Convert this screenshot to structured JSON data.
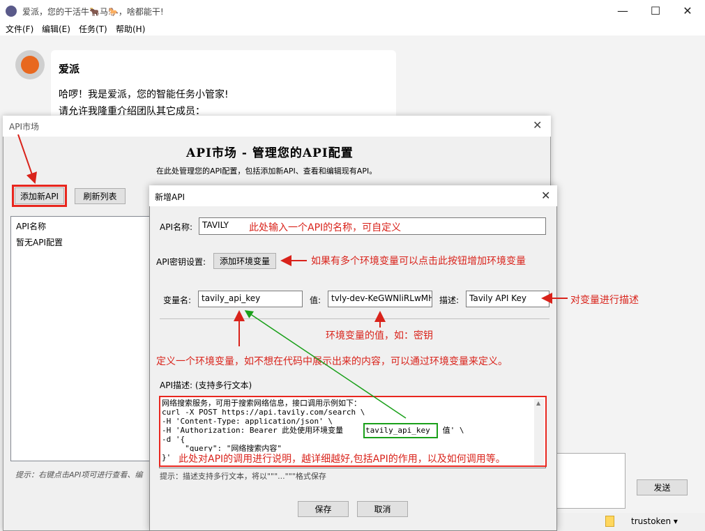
{
  "window": {
    "title": "爱派，您的干活牛🐂马🐎，啥都能干!",
    "minimize": "—",
    "maximize": "☐",
    "close": "✕"
  },
  "menu": [
    "文件(F)",
    "编辑(E)",
    "任务(T)",
    "帮助(H)"
  ],
  "chat": {
    "bot_name": "爱派",
    "greeting_line1": "哈啰！我是爱派，您的智能任务小管家!",
    "greeting_line2": "请允许我隆重介绍团队其它成员：",
    "send_label": "发送",
    "user_select": "trustoken ▾"
  },
  "market": {
    "title": "API市场",
    "close": "✕",
    "heading": "API市场 - 管理您的API配置",
    "subtitle": "在此处管理您的API配置，包括添加新API、查看和编辑现有API。",
    "add_button": "添加新API",
    "refresh_button": "刷新列表",
    "list_header": "API名称",
    "list_empty": "暂无API配置",
    "hint": "提示：右键点击API项可进行查看、编"
  },
  "new_api": {
    "title": "新增API",
    "close": "✕",
    "name_label": "API名称:",
    "name_value": "TAVILY",
    "key_settings_label": "API密钥设置:",
    "add_env_button": "添加环境变量",
    "var_name_label": "变量名:",
    "var_name_value": "tavily_api_key",
    "value_label": "值:",
    "value_value": "tvly-dev-KeGWNliRLwMH",
    "desc_label": "描述:",
    "desc_value": "Tavily API Key",
    "api_desc_label": "API描述: (支持多行文本)",
    "desc_lines": [
      "网络搜索服务，可用于搜索网络信息，接口调用示例如下：",
      "curl -X POST https://api.tavily.com/search \\",
      "-H 'Content-Type: application/json' \\",
      "-H 'Authorization: Bearer 此处使用环境变量 ",
      "tavily_api_key",
      " 值' \\",
      "-d '{",
      "     \"query\": \"网络搜索内容\"",
      "}'"
    ],
    "desc_hint": "提示：描述支持多行文本，将以\"\"\"...\"\"\"格式保存",
    "save_button": "保存",
    "cancel_button": "取消"
  },
  "annotations": {
    "name_note": "此处输入一个API的名称，可自定义",
    "env_button_note": "如果有多个环境变量可以点击此按钮增加环境变量",
    "desc_note": "对变量进行描述",
    "value_note": "环境变量的值，如：密钥",
    "var_note": "定义一个环境变量，如不想在代码中展示出来的内容，可以通过环境变量来定义。",
    "api_desc_note": "此处对API的调用进行说明，越详细越好,包括API的作用，以及如何调用等。"
  },
  "colors": {
    "annotation": "#d9231b",
    "highlight_green": "#1aa01a"
  }
}
